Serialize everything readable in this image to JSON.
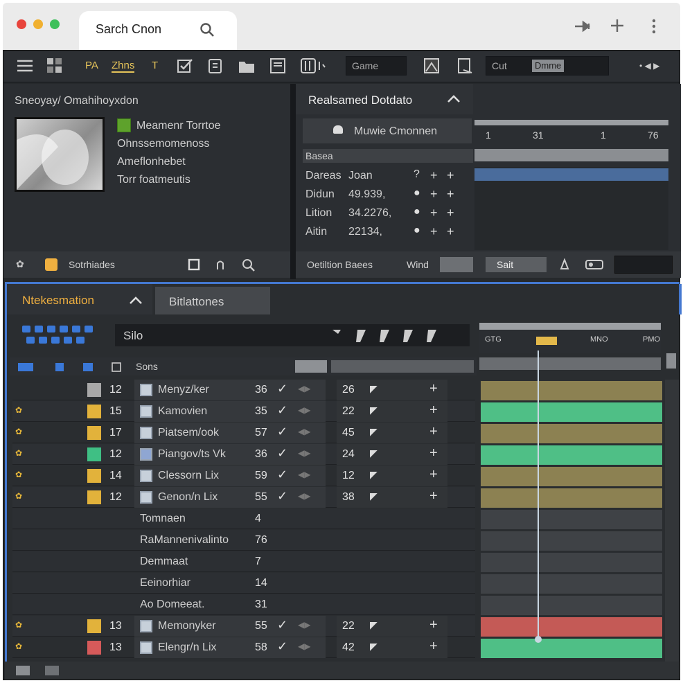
{
  "browser": {
    "tab_title": "Sarch Cnon",
    "controls": {
      "pin": "pin-icon",
      "new_tab": "+",
      "menu": "⋮"
    }
  },
  "toolbar": {
    "label_pa": "PA",
    "label_zones": "Zhns",
    "label_t": "T",
    "field_game": "Game",
    "field_cut": "Cut",
    "field_chip": "Dmme",
    "right_label": "• ◀ ▶"
  },
  "source_panel": {
    "title": "Sneoyay/ Omahihoyxdon",
    "items": [
      "Meamenr Torrtoe",
      "Ohnssemomenoss",
      "Ameflonhebet",
      "Torr foatmeutis"
    ],
    "footer_label": "Sotrhiades"
  },
  "detail_panel": {
    "title": "Realsamed Dotdato",
    "button": "Muwie Cmonnen",
    "ruler": [
      "1",
      "31",
      "1",
      "76"
    ],
    "section": "Basea",
    "rows": [
      {
        "name": "Dareas",
        "value": "Joan",
        "icon": "?"
      },
      {
        "name": "Didun",
        "value": "49.939,",
        "icon": "drop"
      },
      {
        "name": "Lition",
        "value": "34.2276,",
        "icon": "drop"
      },
      {
        "name": "Aitin",
        "value": "22134,",
        "icon": "drop"
      }
    ],
    "footer_label": "Oetiltion Baees",
    "footer_wind": "Wind",
    "footer_btn": "Sait"
  },
  "timeline_panel": {
    "tab_active": "Ntekesmation",
    "tab_other": "Bitlattones",
    "search_value": "Silo",
    "header_label": "Sons",
    "ruler_labels": [
      "GTG",
      "",
      "MNO",
      "PMO"
    ],
    "rows": [
      {
        "warn": false,
        "swatch": "#a8a8a8",
        "id": "12",
        "name": "Menyz/ker",
        "v1": "36",
        "v2": "26",
        "bar": "#8c8152",
        "cb": "#c7d0da"
      },
      {
        "warn": true,
        "swatch": "#e2b23b",
        "id": "15",
        "name": "Kamovien",
        "v1": "35",
        "v2": "22",
        "bar": "#4fbf86",
        "cb": "#c7d0da"
      },
      {
        "warn": true,
        "swatch": "#e2b23b",
        "id": "17",
        "name": "Piatsem/ook",
        "v1": "57",
        "v2": "45",
        "bar": "#8c8152",
        "cb": "#c7d0da"
      },
      {
        "warn": true,
        "swatch": "#3fbf84",
        "id": "12",
        "name": "Piangov/ts Vk",
        "v1": "36",
        "v2": "24",
        "bar": "#4fbf86",
        "cb": "#8fa6d2"
      },
      {
        "warn": true,
        "swatch": "#e2b23b",
        "id": "14",
        "name": "Clessorn Lix",
        "v1": "59",
        "v2": "12",
        "bar": "#8c8152",
        "cb": "#c7d0da"
      },
      {
        "warn": true,
        "swatch": "#e2b23b",
        "id": "12",
        "name": "Genon/n Lix",
        "v1": "55",
        "v2": "38",
        "bar": "#8c8152",
        "cb": "#c7d0da"
      }
    ],
    "summary": [
      {
        "name": "Tomnaen",
        "value": "4"
      },
      {
        "name": "RaMannenivalinto",
        "value": "76"
      },
      {
        "name": "Demmaat",
        "value": "7"
      },
      {
        "name": "Eeinorhiar",
        "value": "14"
      },
      {
        "name": "Ao Domeeat.",
        "value": "31"
      }
    ],
    "rows_bottom": [
      {
        "warn": true,
        "swatch": "#e2b23b",
        "id": "13",
        "name": "Memonyker",
        "v1": "55",
        "v2": "22",
        "bar": "#c45a56",
        "cb": "#c7d0da"
      },
      {
        "warn": true,
        "swatch": "#d65a5a",
        "id": "13",
        "name": "Elengr/n Lix",
        "v1": "58",
        "v2": "42",
        "bar": "#4fbf86",
        "cb": "#c7d0da"
      }
    ]
  },
  "colors": {
    "accent_blue": "#4478d0",
    "tab_orange": "#f0b040",
    "playhead": "#c9d6e2"
  }
}
